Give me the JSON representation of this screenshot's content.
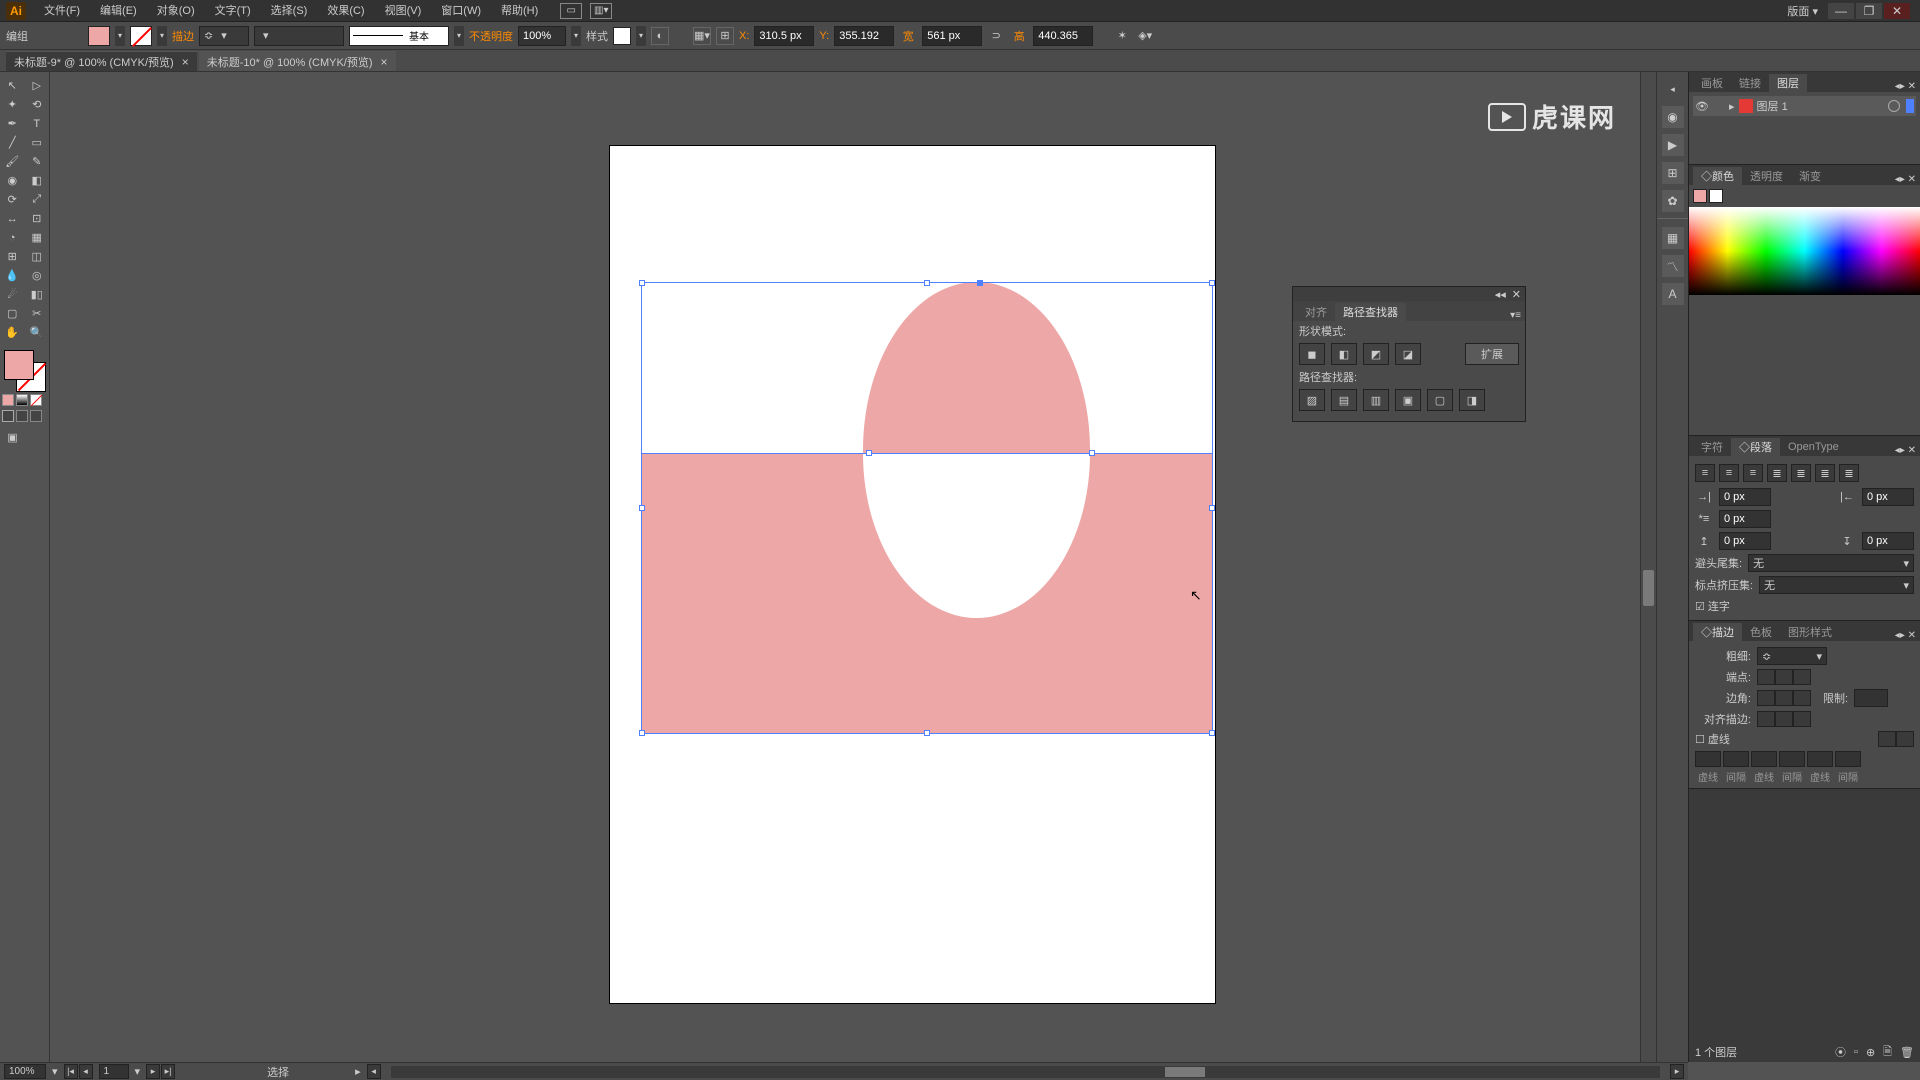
{
  "menubar": {
    "items": [
      "文件(F)",
      "编辑(E)",
      "对象(O)",
      "文字(T)",
      "选择(S)",
      "效果(C)",
      "视图(V)",
      "窗口(W)",
      "帮助(H)"
    ],
    "right_label": "版面"
  },
  "options": {
    "group_label": "编组",
    "stroke_label": "描边",
    "stroke_style_label": "基本",
    "opacity_label": "不透明度",
    "opacity_value": "100%",
    "style_label": "样式",
    "x_value": "310.5 px",
    "y_value": "355.192",
    "w_label": "宽",
    "w_value": "561 px",
    "h_label": "高",
    "h_value": "440.365"
  },
  "tabs": [
    {
      "label": "未标题-9* @ 100% (CMYK/预览)",
      "active": false
    },
    {
      "label": "未标题-10* @ 100% (CMYK/预览)",
      "active": true
    }
  ],
  "color": {
    "pink_fill": "#eda7a6"
  },
  "layers_panel": {
    "tabs": [
      "画板",
      "链接",
      "图层"
    ],
    "active_tab": 2,
    "layer_name": "图层 1",
    "footer": "1 个图层"
  },
  "color_panel": {
    "tabs": [
      "◇颜色",
      "透明度",
      "渐变"
    ],
    "active_tab": 0
  },
  "paragraph_panel": {
    "tabs": [
      "字符",
      "◇段落",
      "OpenType"
    ],
    "active_tab": 1,
    "indent_left": "0 px",
    "indent_right": "0 px",
    "indent_first": "0 px",
    "space_before": "0 px",
    "space_after": "0 px",
    "hyphen_last_label": "避头尾集:",
    "hyphen_last_value": "无",
    "kinsoku_label": "标点挤压集:",
    "kinsoku_value": "无",
    "hyphenate_label": "连字"
  },
  "stroke_panel": {
    "tabs": [
      "◇描边",
      "色板",
      "图形样式"
    ],
    "active_tab": 0,
    "weight_label": "粗细:",
    "cap_label": "端点:",
    "corner_label": "边角:",
    "limit_label": "限制:",
    "align_label": "对齐描边:",
    "dashed_label": "虚线",
    "dash_labels": [
      "虚线",
      "间隔",
      "虚线",
      "间隔",
      "虚线",
      "间隔"
    ]
  },
  "pathfinder": {
    "tabs": [
      "对齐",
      "路径查找器"
    ],
    "shape_modes_label": "形状模式:",
    "expand_label": "扩展",
    "pathfinders_label": "路径查找器:"
  },
  "status": {
    "zoom": "100%",
    "artboard": "1",
    "tool_name": "选择"
  },
  "watermark": "虎课网"
}
